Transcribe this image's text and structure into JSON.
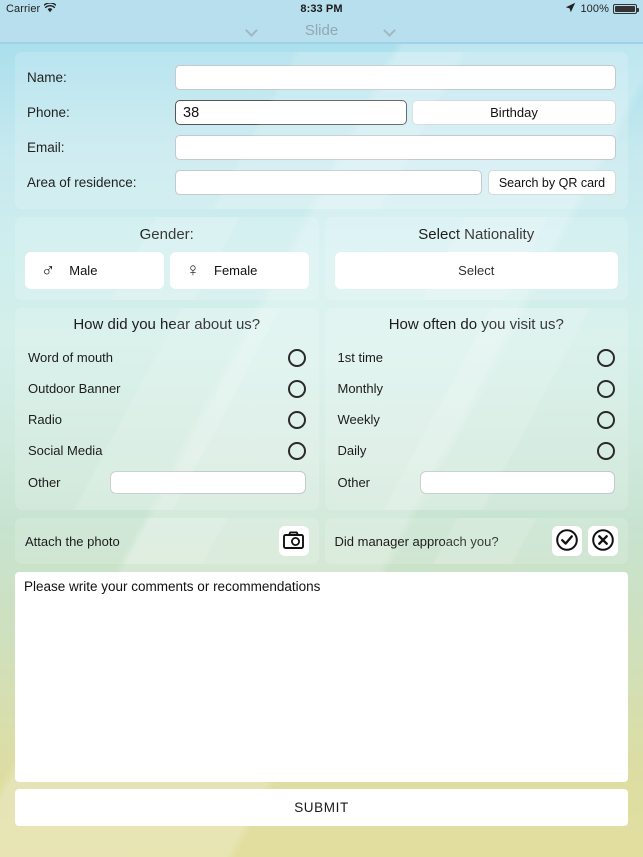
{
  "statusbar": {
    "carrier": "Carrier",
    "wifi_icon": "wifi-icon",
    "time": "8:33 PM",
    "location_icon": "location-arrow-icon",
    "battery_percent": "100%",
    "battery_icon": "battery-full-icon"
  },
  "navbar": {
    "title": "Slide",
    "left_icon": "chevron-down-icon",
    "right_icon": "chevron-down-icon"
  },
  "contact": {
    "name_label": "Name:",
    "name_value": "",
    "name_placeholder": "",
    "phone_label": "Phone:",
    "phone_value": "38",
    "phone_placeholder": "",
    "birthday_label": "Birthday",
    "email_label": "Email:",
    "email_value": "",
    "email_placeholder": "",
    "area_label": "Area of residence:",
    "area_value": "",
    "area_placeholder": "",
    "qr_label": "Search by QR card"
  },
  "gender": {
    "title": "Gender:",
    "male_label": "Male",
    "male_symbol": "♂",
    "female_label": "Female",
    "female_symbol": "♀"
  },
  "nationality": {
    "title": "Select Nationality",
    "select_label": "Select"
  },
  "hear_about": {
    "title": "How did you hear about us?",
    "options": [
      {
        "label": "Word of mouth"
      },
      {
        "label": "Outdoor Banner"
      },
      {
        "label": "Radio"
      },
      {
        "label": "Social Media"
      }
    ],
    "other_label": "Other",
    "other_value": "",
    "other_placeholder": ""
  },
  "visit_often": {
    "title": "How often do you visit us?",
    "options": [
      {
        "label": "1st time"
      },
      {
        "label": "Monthly"
      },
      {
        "label": "Weekly"
      },
      {
        "label": "Daily"
      }
    ],
    "other_label": "Other",
    "other_value": "",
    "other_placeholder": ""
  },
  "attach": {
    "label": "Attach the photo",
    "icon": "camera-icon"
  },
  "manager": {
    "label": "Did manager approach you?",
    "yes_icon": "check-circle-icon",
    "no_icon": "x-circle-icon"
  },
  "comments": {
    "placeholder": "Please write your comments or recommendations",
    "value": ""
  },
  "submit": {
    "label": "SUBMIT"
  },
  "colors": {
    "bg_top": "#8ed5ea",
    "bg_mid": "#cfe9dd",
    "bg_bottom": "#e2de9e",
    "navbar": "#b8dfee",
    "nav_title": "#8fa8b2",
    "field_bg": "#ffffff",
    "text": "#1c1c1c"
  }
}
